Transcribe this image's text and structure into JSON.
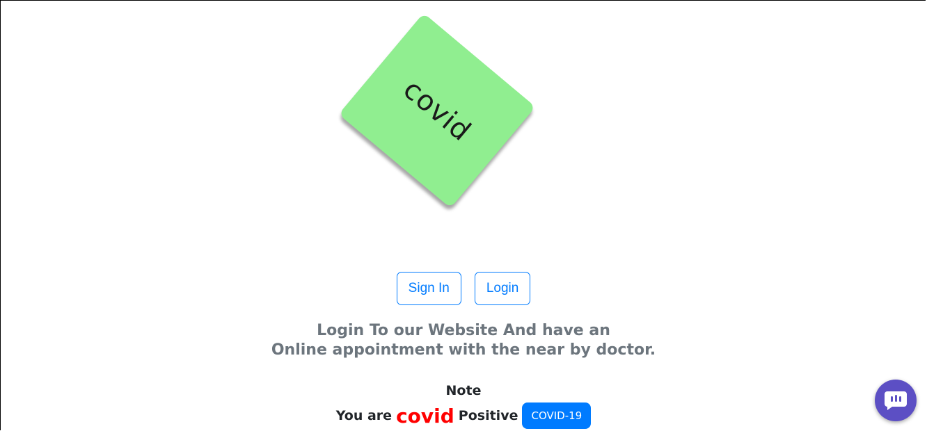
{
  "logo": {
    "text": "covid",
    "color": "#90ee90"
  },
  "buttons": {
    "sign_in_label": "Sign In",
    "login_label": "Login",
    "accent": "#007bff"
  },
  "tagline": {
    "line1": "Login To our Website And have an",
    "line2": "Online appointment with the near by doctor."
  },
  "note": {
    "title": "Note",
    "prefix": "You are",
    "highlight": "covid",
    "suffix": "Positive",
    "badge": "COVID-19"
  },
  "chat_widget": {
    "icon": "chat-bubble-icon",
    "color": "#5c4fc4"
  }
}
